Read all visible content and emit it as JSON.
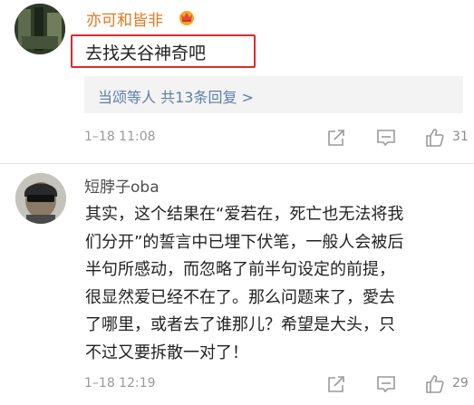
{
  "comments": [
    {
      "username": "亦可和皆非",
      "text": "去找关谷神奇吧",
      "reply_summary": "当颂等人  共13条回复 >",
      "timestamp": "1–18 11:08",
      "likes": "31",
      "badge_icon": "vip-crown-icon"
    },
    {
      "username": "短脖子oba",
      "text": "其实，这个结果在“爱若在，死亡也无法将我\n们分开”的誓言中已埋下伏笔，一般人会被后\n半句所感动，而忽略了前半句设定的前提，\n很显然爱已经不在了。那么问题来了，愛去\n了哪里，或者去了谁那儿？希望是大头，只\n不过又要拆散一对了！",
      "timestamp": "1–18 12:19",
      "likes": "29"
    }
  ],
  "colors": {
    "vip_username": "#e3781f",
    "username": "#4d4d4d",
    "link": "#5d7fa8",
    "highlight_border": "#e02a2a",
    "meta_gray": "#9a9a9a"
  },
  "action_icons": [
    "share-icon",
    "comment-icon",
    "like-icon"
  ]
}
